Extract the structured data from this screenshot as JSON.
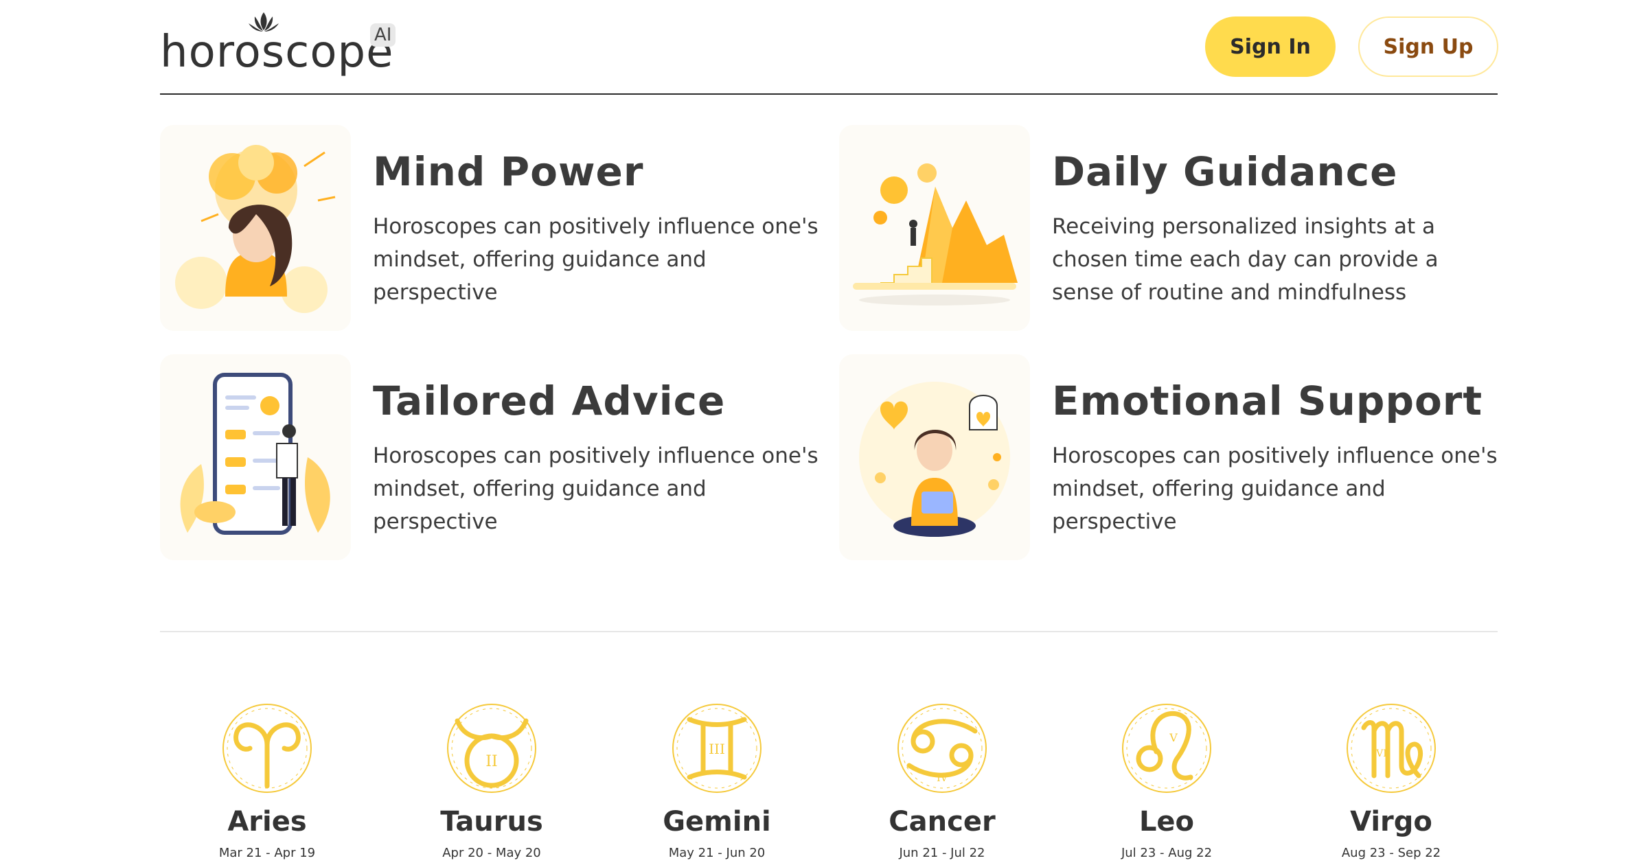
{
  "header": {
    "logo_text": "horoscope",
    "logo_badge": "AI",
    "signin_label": "Sign In",
    "signup_label": "Sign Up"
  },
  "features": [
    {
      "title": "Mind Power",
      "desc": "Horoscopes can positively influence one's mindset, offering guidance and perspective"
    },
    {
      "title": "Daily Guidance",
      "desc": "Receiving personalized insights at a chosen time each day can provide a sense of routine and mindfulness"
    },
    {
      "title": "Tailored Advice",
      "desc": "Horoscopes can positively influence one's mindset, offering guidance and perspective"
    },
    {
      "title": "Emotional Support",
      "desc": "Horoscopes can positively influence one's mindset, offering guidance and perspective"
    }
  ],
  "zodiac": [
    {
      "name": "Aries",
      "dates": "Mar 21 - Apr 19"
    },
    {
      "name": "Taurus",
      "dates": "Apr 20 - May 20"
    },
    {
      "name": "Gemini",
      "dates": "May 21 - Jun 20"
    },
    {
      "name": "Cancer",
      "dates": "Jun 21 - Jul 22"
    },
    {
      "name": "Leo",
      "dates": "Jul 23 - Aug 22"
    },
    {
      "name": "Virgo",
      "dates": "Aug 23 - Sep 22"
    }
  ],
  "colors": {
    "accent_yellow": "#ffdb4d",
    "signup_text": "#8a4a10",
    "zodiac_gold": "#f5c93a"
  }
}
